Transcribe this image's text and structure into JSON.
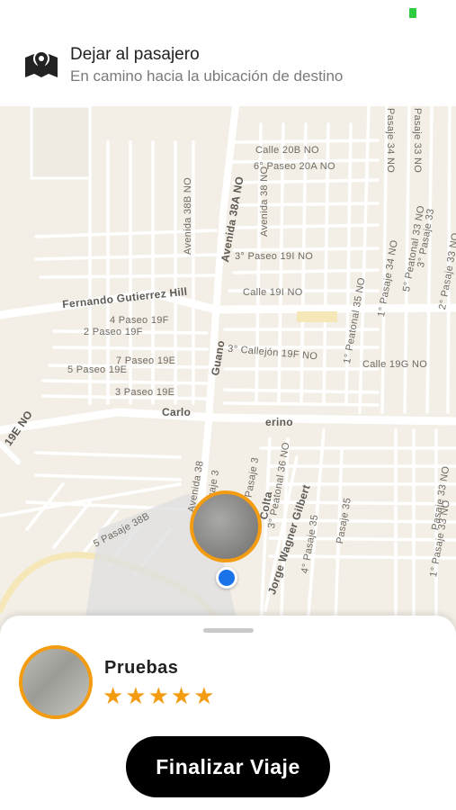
{
  "header": {
    "icon": "map-icon",
    "title": "Dejar al pasajero",
    "subtitle": "En camino hacia la ubicación de destino"
  },
  "map": {
    "street_labels": {
      "calle_20b_no": "Calle 20B NO",
      "paseo_20a_no": "6° Paseo 20A NO",
      "avenida_38b_no": "Avenida 38B NO",
      "avenida_38a_no": "Avenida 38A NO",
      "avenida_38_no": "Avenida 38 NO",
      "paseo_19i_no": "3° Paseo 19I NO",
      "calle_19i_no": "Calle 19I NO",
      "fernando": "Fernando Gutierrez Hill",
      "paseo4_19f": "4 Paseo 19F",
      "paseo2_19f": "2 Paseo 19F",
      "callejon_19f_no": "3° Callejón 19F NO",
      "calle_19g_no": "Calle 19G NO",
      "paseo7_19e": "7 Paseo 19E",
      "paseo5_19e": "5 Paseo 19E",
      "paseo3_19e": "3 Paseo 19E",
      "guano": "Guano",
      "carlo": "Carlo",
      "erino": "erino",
      "e19_no": "19E NO",
      "av38_lower": "Avenida 38",
      "pasaje2": "2° Pasaje 3",
      "pasaje1": "1° Pasaje 3",
      "colta": "Colta",
      "peatonal36": "3° Peatonal 36 NO",
      "jorge": "Jorge Wagner Gilbert",
      "pasaje35_4": "4° Pasaje 35",
      "pasaje35": "Pasaje 35",
      "pasaje38b_5": "5 Pasaje 38B",
      "peatonal35": "1° Peatonal 35 NO",
      "pasaje34": "1° Pasaje 34 NO",
      "peatonal33": "5° Peatonal 33 NO",
      "pasaje33_3": "3° Pasaje 33",
      "pasaje33_2": "2° Pasaje 33 NO",
      "pasaje34_top": "Pasaje 34 NO",
      "pasaje33_top": "Pasaje 33 NO",
      "pasaje33_lower": "1° Pasaje 33 NO",
      "pasaje33_right": "Pasaje 33 NO"
    }
  },
  "passenger": {
    "name": "Pruebas",
    "rating": 5,
    "stars": "★★★★★"
  },
  "actions": {
    "finish_label": "Finalizar Viaje"
  },
  "colors": {
    "accent": "#f39c12",
    "location": "#1a73e8",
    "button": "#000000",
    "map_bg": "#f3efe6"
  }
}
